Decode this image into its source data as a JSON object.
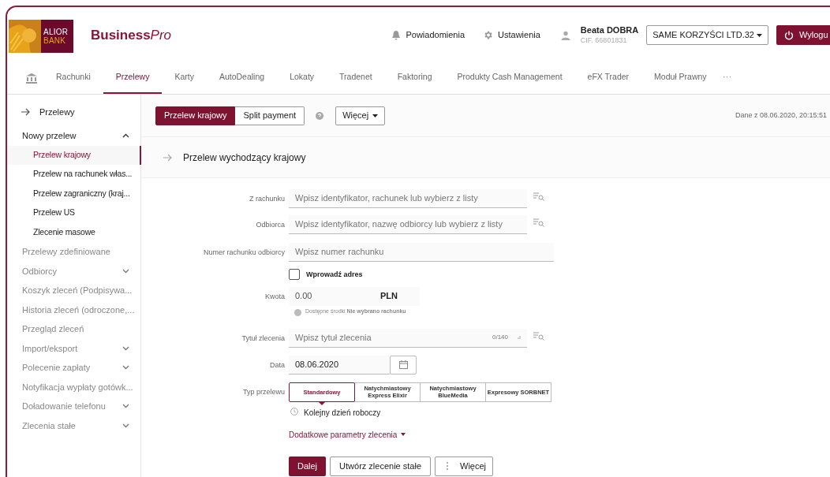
{
  "header": {
    "logo": {
      "line_1": "ALIOR",
      "line_2": "BANK"
    },
    "brand": {
      "main": "Business",
      "accent": "Pro"
    },
    "notifications": "Powiadomienia",
    "settings": "Ustawienia",
    "user": {
      "name": "Beata DOBRA",
      "cif": "CIF. 66801831"
    },
    "company": "SAME KORZYŚCI LTD.32",
    "logout": "Wylogu"
  },
  "nav": {
    "tabs": [
      {
        "label": "Rachunki",
        "selected": false
      },
      {
        "label": "Przelewy",
        "selected": true
      },
      {
        "label": "Karty",
        "selected": false
      },
      {
        "label": "AutoDealing",
        "selected": false
      },
      {
        "label": "Lokaty",
        "selected": false
      },
      {
        "label": "Tradenet",
        "selected": false
      },
      {
        "label": "Faktoring",
        "selected": false
      },
      {
        "label": "Produkty Cash Management",
        "selected": false
      },
      {
        "label": "eFX Trader",
        "selected": false
      },
      {
        "label": "Moduł Prawny",
        "selected": false
      }
    ],
    "more": "···"
  },
  "sidebar": {
    "back": "Przelewy",
    "items": [
      {
        "label": "Nowy przelew",
        "kind": "group",
        "expanded": true,
        "children": [
          {
            "label": "Przelew krajowy",
            "selected": true
          },
          {
            "label": "Przelew na rachunek włas...",
            "selected": false
          },
          {
            "label": "Przelew zagraniczny (kraj...",
            "selected": false
          },
          {
            "label": "Przelew US",
            "selected": false
          },
          {
            "label": "Zlecenie masowe",
            "selected": false
          }
        ]
      },
      {
        "label": "Przelewy zdefiniowane",
        "kind": "link"
      },
      {
        "label": "Odbiorcy",
        "kind": "group",
        "expanded": false
      },
      {
        "label": "Koszyk zleceń (Podpisywa...",
        "kind": "link"
      },
      {
        "label": "Historia zleceń (odroczone,...",
        "kind": "link"
      },
      {
        "label": "Przegląd zleceń",
        "kind": "link"
      },
      {
        "label": "Import/eksport",
        "kind": "group",
        "expanded": false
      },
      {
        "label": "Polecenie zapłaty",
        "kind": "group",
        "expanded": false
      },
      {
        "label": "Notyfikacja wypłaty gotówk...",
        "kind": "link"
      },
      {
        "label": "Doładowanie telefonu",
        "kind": "group",
        "expanded": false
      },
      {
        "label": "Zlecenia stałe",
        "kind": "group",
        "expanded": false
      }
    ]
  },
  "toolbar": {
    "segments": [
      {
        "label": "Przelew krajowy",
        "selected": true
      },
      {
        "label": "Split payment",
        "selected": false
      }
    ],
    "more": "Więcej",
    "data_time": "Dane z 08.06.2020, 20:15:51"
  },
  "section_title": "Przelew wychodzący krajowy",
  "form": {
    "from_account": {
      "label": "Z rachunku",
      "placeholder": "Wpisz identyfikator, rachunek lub wybierz z listy"
    },
    "recipient": {
      "label": "Odbiorca",
      "placeholder": "Wpisz identyfikator, nazwę odbiorcy lub wybierz z listy"
    },
    "account_number": {
      "label": "Numer rachunku odbiorcy",
      "placeholder": "Wpisz numer rachunku"
    },
    "address": {
      "label": "Wprowadź adres",
      "checked": false
    },
    "amount": {
      "label": "Kwota",
      "value": "0.00",
      "currency": "PLN",
      "hint_label": "Dostępne środki",
      "hint_value": "Nie wybrano rachunku"
    },
    "title": {
      "label": "Tytuł zlecenia",
      "placeholder": "Wpisz tytuł zlecenia",
      "counter": "0/140"
    },
    "date": {
      "label": "Data",
      "value": "08.06.2020"
    },
    "transfer_type": {
      "label": "Typ przelewu",
      "options": [
        {
          "label": "Standardowy",
          "selected": true
        },
        {
          "label": "Natychmiastowy Express Elixir",
          "selected": false
        },
        {
          "label": "Natychmiastowy BlueMedia",
          "selected": false
        },
        {
          "label": "Expresowy SORBNET",
          "selected": false
        }
      ],
      "note": "Kolejny dzień roboczy"
    },
    "extra_params": "Dodatkowe parametry zlecenia",
    "buttons": {
      "next": "Dalej",
      "standing_order": "Utwórz zlecenie stałe",
      "more": "Więcej"
    }
  }
}
